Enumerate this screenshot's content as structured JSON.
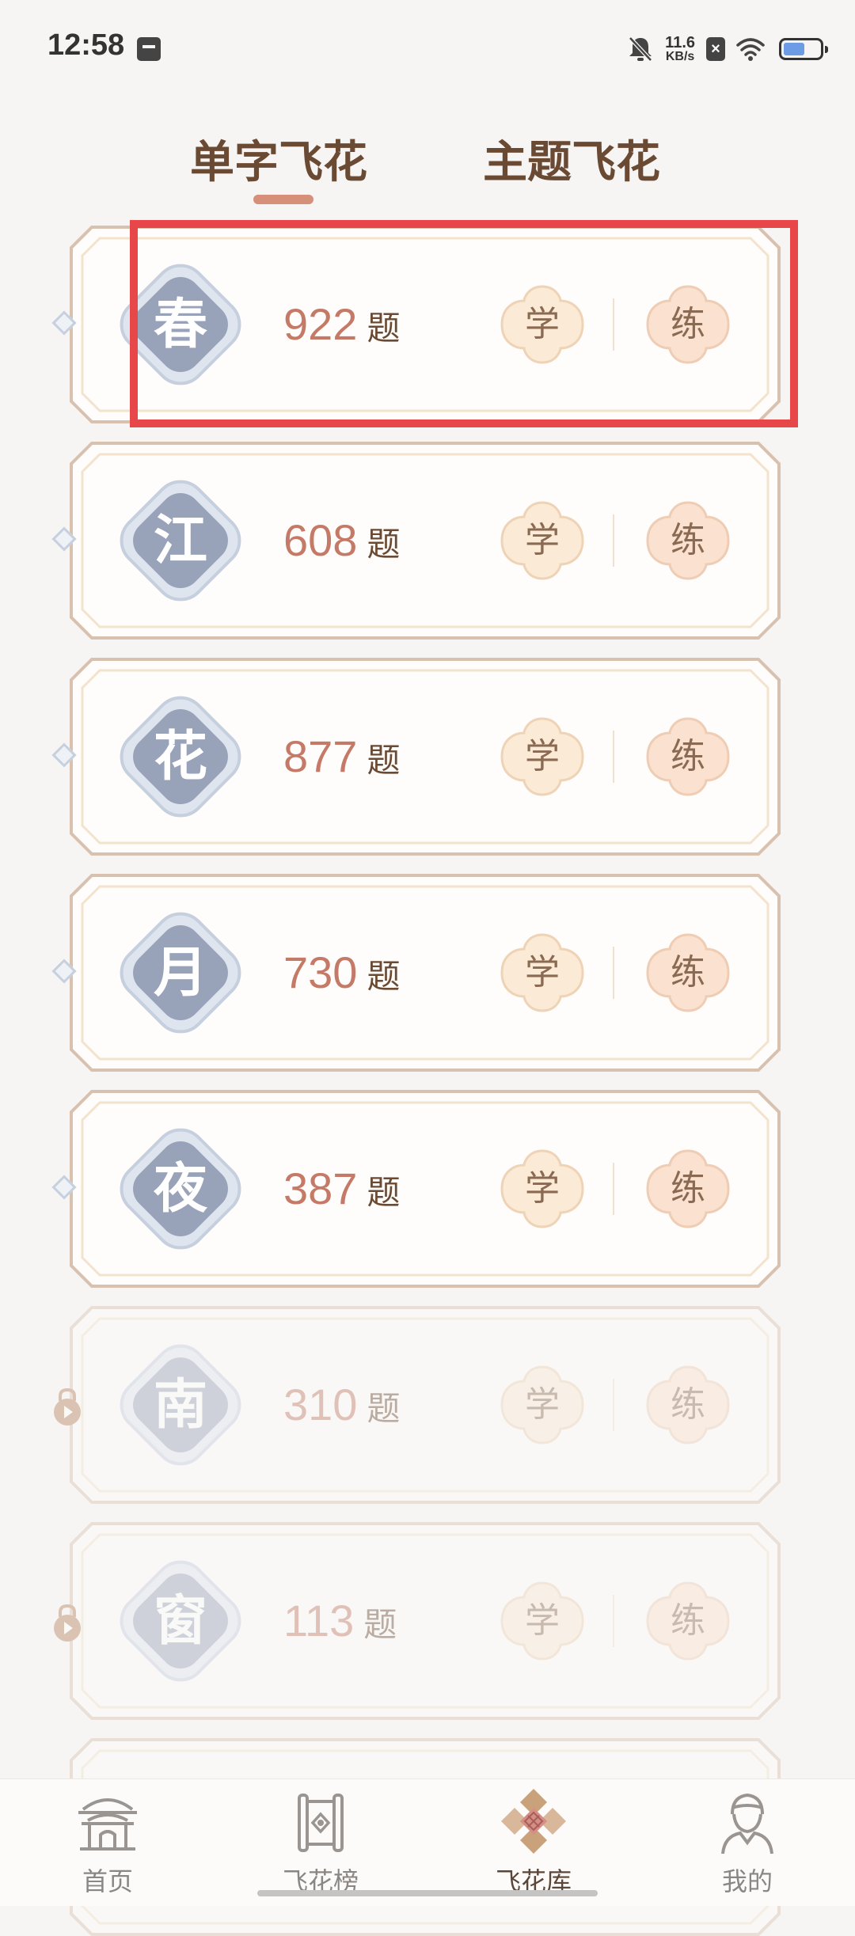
{
  "status_bar": {
    "time": "12:58",
    "net_speed_value": "11.6",
    "net_speed_unit": "KB/s",
    "battery_level": 0.6
  },
  "tabs": [
    {
      "label": "单字飞花",
      "active": true
    },
    {
      "label": "主题飞花",
      "active": false
    }
  ],
  "cards": [
    {
      "char": "春",
      "count": "922",
      "unit": "题",
      "learn": "学",
      "practice": "练",
      "locked": false
    },
    {
      "char": "江",
      "count": "608",
      "unit": "题",
      "learn": "学",
      "practice": "练",
      "locked": false
    },
    {
      "char": "花",
      "count": "877",
      "unit": "题",
      "learn": "学",
      "practice": "练",
      "locked": false
    },
    {
      "char": "月",
      "count": "730",
      "unit": "题",
      "learn": "学",
      "practice": "练",
      "locked": false
    },
    {
      "char": "夜",
      "count": "387",
      "unit": "题",
      "learn": "学",
      "practice": "练",
      "locked": false
    },
    {
      "char": "南",
      "count": "310",
      "unit": "题",
      "learn": "学",
      "practice": "练",
      "locked": true
    },
    {
      "char": "窗",
      "count": "113",
      "unit": "题",
      "learn": "学",
      "practice": "练",
      "locked": true
    }
  ],
  "bottom_nav": [
    {
      "label": "首页",
      "icon": "home-pavilion-icon",
      "active": false
    },
    {
      "label": "飞花榜",
      "icon": "scroll-rank-icon",
      "active": false
    },
    {
      "label": "飞花库",
      "icon": "flower-library-icon",
      "active": true
    },
    {
      "label": "我的",
      "icon": "profile-icon",
      "active": false
    }
  ],
  "colors": {
    "accent": "#c47a66",
    "tab_indicator": "#d68f78",
    "highlight": "#e8474a",
    "diamond": "#98a2b8"
  }
}
